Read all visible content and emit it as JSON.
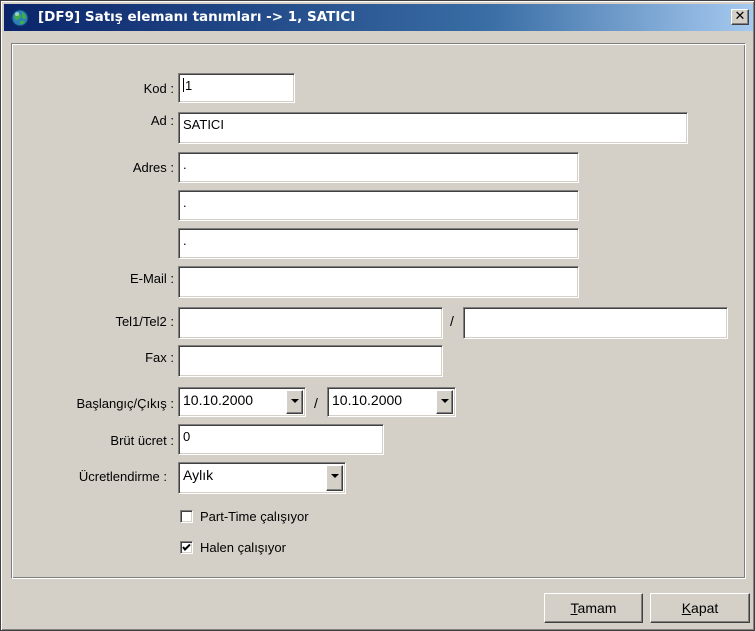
{
  "window": {
    "title": "[DF9] Satış elemanı tanımları -> 1, SATICI",
    "close_label": "✕"
  },
  "form": {
    "kod": {
      "label": "Kod :",
      "value": "1"
    },
    "ad": {
      "label": "Ad :",
      "value": "SATICI"
    },
    "adres": {
      "label": "Adres :",
      "lines": [
        ".",
        ".",
        "."
      ]
    },
    "email": {
      "label": "E-Mail :",
      "value": ""
    },
    "tel": {
      "label": "Tel1/Tel2 :",
      "tel1": "",
      "separator": "/",
      "tel2": ""
    },
    "fax": {
      "label": "Fax :",
      "value": ""
    },
    "dates": {
      "label": "Başlangıç/Çıkış :",
      "start": "10.10.2000",
      "separator": "/",
      "end": "10.10.2000"
    },
    "brut_ucret": {
      "label": "Brüt ücret :",
      "value": "0"
    },
    "ucretlendirme": {
      "label": "Ücretlendirme :",
      "value": "Aylık"
    },
    "part_time": {
      "label": "Part-Time çalışıyor",
      "checked": false
    },
    "halen": {
      "label": "Halen çalışıyor",
      "checked": true
    }
  },
  "buttons": {
    "ok": {
      "mnemonic": "T",
      "rest": "amam"
    },
    "close": {
      "mnemonic": "K",
      "rest": "apat"
    }
  }
}
